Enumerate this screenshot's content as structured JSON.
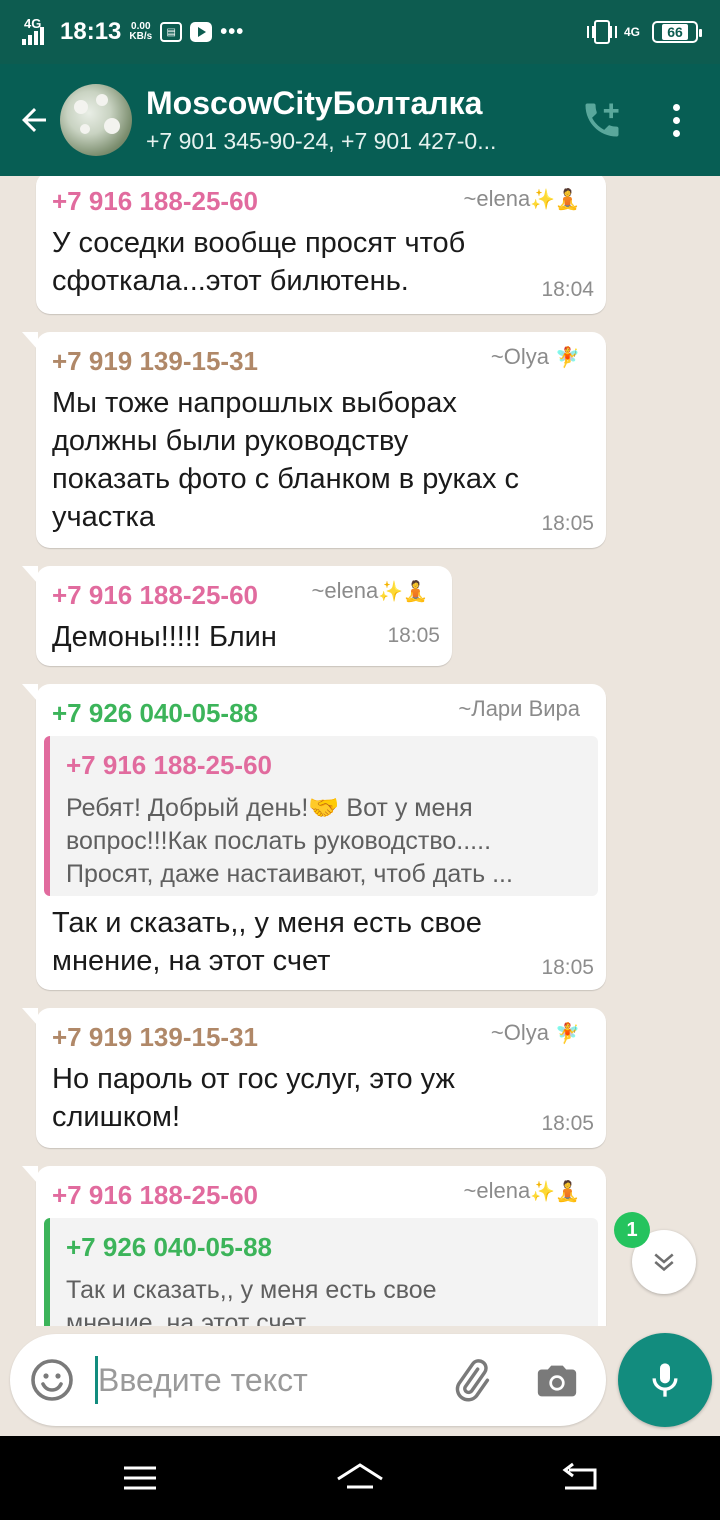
{
  "status_bar": {
    "network_left": "4G",
    "time": "18:13",
    "speed_value": "0.00",
    "speed_unit": "KB/s",
    "more": "•••",
    "network_right": "4G",
    "battery": "66"
  },
  "header": {
    "group_name": "MoscowCityБолталка",
    "members": "+7 901 345-90-24, +7 901 427-0..."
  },
  "messages": [
    {
      "sender": "+7 916 188-25-60",
      "alias": "~elena",
      "alias_emoji": "✨🧘",
      "text": "У соседки вообще просят чтоб\nсфоткала...этот билютень.",
      "time": "18:04"
    },
    {
      "sender": "+7 919 139-15-31",
      "alias": "~Olya",
      "alias_emoji": "🧚",
      "text": "Мы тоже напрошлых выборах\nдолжны были руководству\nпоказать фото с бланком в руках с\nучастка",
      "time": "18:05"
    },
    {
      "sender": "+7 916 188-25-60",
      "alias": "~elena",
      "alias_emoji": "✨🧘",
      "text": "Демоны!!!!! Блин",
      "time": "18:05"
    },
    {
      "sender": "+7 926 040-05-88",
      "alias": "~Лари Вира",
      "quote": {
        "sender": "+7 916 188-25-60",
        "line1": "Ребят! Добрый день!🤝 Вот у меня",
        "line2": "вопрос!!!Как послать руководство.....",
        "line3": "Просят, даже настаивают, чтоб дать ..."
      },
      "text": "Так и сказать,, у меня есть свое\nмнение, на этот счет",
      "time": "18:05"
    },
    {
      "sender": "+7 919 139-15-31",
      "alias": "~Olya",
      "alias_emoji": "🧚",
      "text": "Но пароль от гос услуг, это уж\nслишком!",
      "time": "18:05"
    },
    {
      "sender": "+7 916 188-25-60",
      "alias": "~elena",
      "alias_emoji": "✨🧘",
      "quote": {
        "sender": "+7 926 040-05-88",
        "line1": "Так и сказать,, у меня есть свое",
        "line2": "мнение, на этот счет"
      }
    }
  ],
  "unread_count": "1",
  "input": {
    "placeholder": "Введите текст"
  },
  "colors": {
    "header": "#075e54",
    "status_bar": "#0d5c50",
    "chat_bg": "#ece5dd",
    "accent": "#128c7e",
    "sender_pink": "#e16b9e",
    "sender_brown": "#b08868",
    "sender_green": "#3cb45a"
  },
  "icons": [
    "back-arrow-icon",
    "add-call-icon",
    "menu-icon",
    "chevron-down-icon",
    "emoji-icon",
    "attach-icon",
    "camera-icon",
    "mic-icon",
    "nav-menu-icon",
    "nav-home-icon",
    "nav-back-icon"
  ]
}
